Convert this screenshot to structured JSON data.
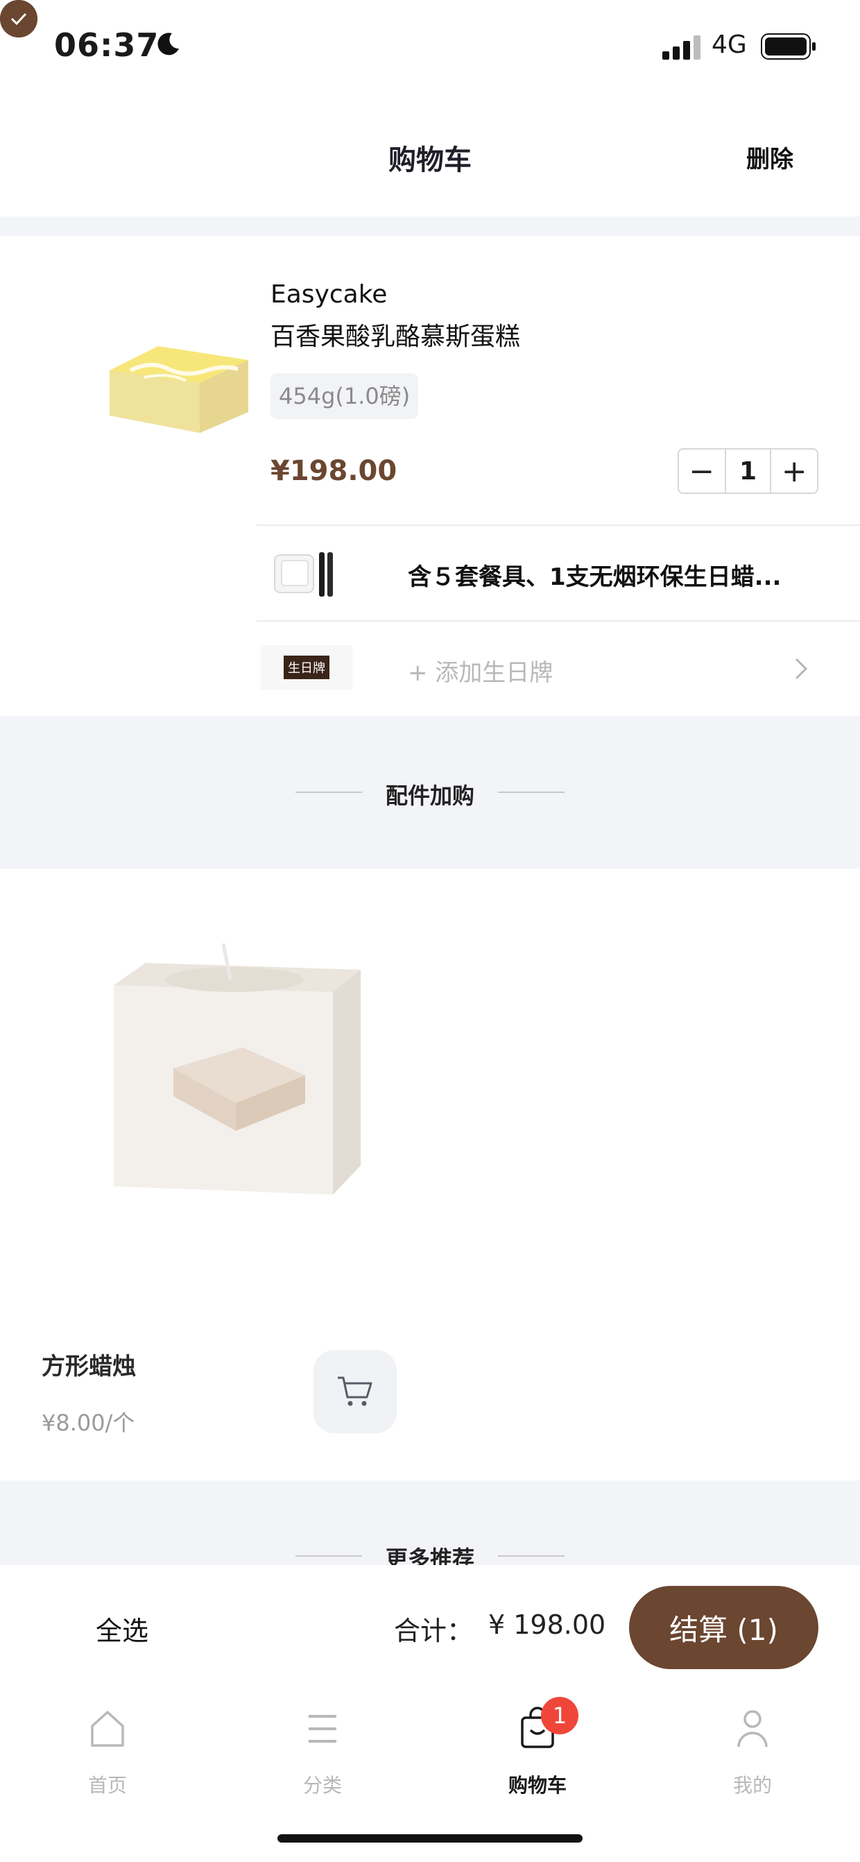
{
  "status_bar": {
    "time": "06:37",
    "network": "4G"
  },
  "header": {
    "title": "购物车",
    "delete_label": "删除"
  },
  "cart_item": {
    "brand": "Easycake",
    "name": "百香果酸乳酪慕斯蛋糕",
    "spec": "454g(1.0磅)",
    "price": "¥198.00",
    "quantity": "1",
    "minus": "−",
    "plus": "+",
    "tableware_text": "含５套餐具、1支无烟环保生日蜡...",
    "plaque_tag": "生日牌",
    "add_plaque_text": "+ 添加生日牌"
  },
  "accessory_section": {
    "title": "配件加购",
    "item": {
      "name": "方形蜡烛",
      "price": "¥8.00/个"
    }
  },
  "more_section": {
    "title": "更多推荐"
  },
  "checkout": {
    "select_all": "全选",
    "total_label": "合计：",
    "total_value": "¥ 198.00",
    "pay_button": "结算 (1)"
  },
  "tabbar": {
    "items": [
      {
        "label": "首页",
        "icon": "home-icon"
      },
      {
        "label": "分类",
        "icon": "menu-icon"
      },
      {
        "label": "购物车",
        "icon": "bag-icon",
        "badge": "1"
      },
      {
        "label": "我的",
        "icon": "user-icon"
      }
    ]
  },
  "colors": {
    "accent": "#6b4630",
    "badge": "#f0463a",
    "band": "#f3f4f8"
  }
}
